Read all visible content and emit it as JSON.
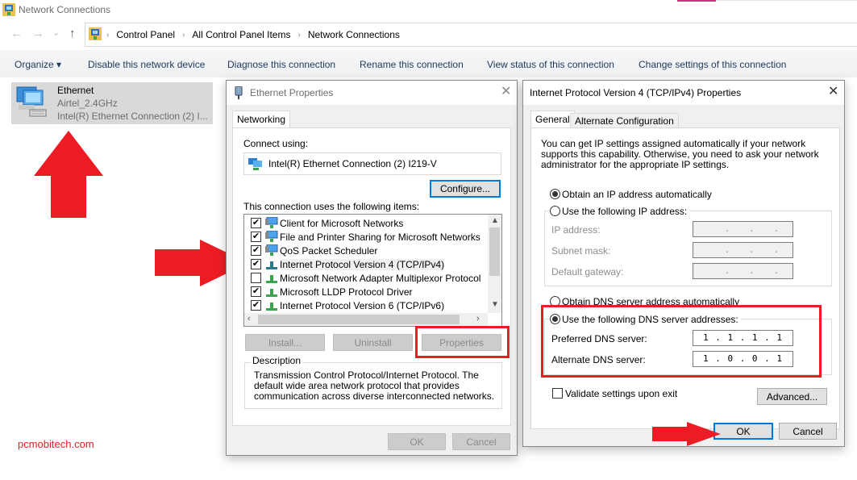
{
  "window": {
    "title": "Network Connections",
    "icon": "network-connections-icon"
  },
  "nav": {
    "back": "←",
    "forward": "→",
    "recent": "⌄",
    "up": "↑"
  },
  "breadcrumb": [
    "Control Panel",
    "All Control Panel Items",
    "Network Connections"
  ],
  "breadcrumb_sep": "›",
  "commands": {
    "organize": "Organize ▾",
    "disable": "Disable this network device",
    "diagnose": "Diagnose this connection",
    "rename": "Rename this connection",
    "view_status": "View status of this connection",
    "change_settings": "Change settings of this connection"
  },
  "connection": {
    "name": "Ethernet",
    "network": "Airtel_2.4GHz",
    "adapter": "Intel(R) Ethernet Connection (2) I..."
  },
  "watermark": "pcmobitech.com",
  "ethernet_properties": {
    "title": "Ethernet Properties",
    "close": "✕",
    "tab": "Networking",
    "connect_using_label": "Connect using:",
    "adapter": "Intel(R) Ethernet Connection (2) I219-V",
    "configure": "Configure...",
    "items_label": "This connection uses the following items:",
    "items": [
      {
        "label": "Client for Microsoft Networks",
        "checked": true,
        "icon": "client-network-icon"
      },
      {
        "label": "File and Printer Sharing for Microsoft Networks",
        "checked": true,
        "icon": "service-network-icon"
      },
      {
        "label": "QoS Packet Scheduler",
        "checked": true,
        "icon": "service-network-icon"
      },
      {
        "label": "Internet Protocol Version 4 (TCP/IPv4)",
        "checked": true,
        "icon": "protocol-icon",
        "selected": true
      },
      {
        "label": "Microsoft Network Adapter Multiplexor Protocol",
        "checked": false,
        "icon": "protocol-icon"
      },
      {
        "label": "Microsoft LLDP Protocol Driver",
        "checked": true,
        "icon": "protocol-icon"
      },
      {
        "label": "Internet Protocol Version 6 (TCP/IPv6)",
        "checked": true,
        "icon": "protocol-icon"
      }
    ],
    "check_mark": "✔",
    "install": "Install...",
    "uninstall": "Uninstall",
    "properties": "Properties",
    "description_label": "Description",
    "description": "Transmission Control Protocol/Internet Protocol. The default wide area network protocol that provides communication across diverse interconnected networks.",
    "ok": "OK",
    "cancel": "Cancel"
  },
  "ipv4_properties": {
    "title": "Internet Protocol Version 4 (TCP/IPv4) Properties",
    "close": "✕",
    "tabs": [
      "General",
      "Alternate Configuration"
    ],
    "intro": "You can get IP settings assigned automatically if your network supports this capability. Otherwise, you need to ask your network administrator for the appropriate IP settings.",
    "obtain_ip_auto": "Obtain an IP address automatically",
    "use_following_ip": "Use the following IP address:",
    "ip_address_label": "IP address:",
    "subnet_label": "Subnet mask:",
    "gateway_label": "Default gateway:",
    "ip_address": "   .   .   .",
    "subnet_mask": "   .   .   .",
    "gateway": "   .   .   .",
    "obtain_dns_auto": "Obtain DNS server address automatically",
    "use_following_dns": "Use the following DNS server addresses:",
    "preferred_dns_label": "Preferred DNS server:",
    "alternate_dns_label": "Alternate DNS server:",
    "preferred_dns": "1 . 1 . 1 . 1",
    "alternate_dns": "1 . 0 . 0 . 1",
    "validate": "Validate settings upon exit",
    "validate_checked": false,
    "advanced": "Advanced...",
    "ok": "OK",
    "cancel": "Cancel"
  },
  "colors": {
    "annotation_red": "#ed1c24",
    "focus_blue": "#0078d7",
    "accent_pink": "#d0307f"
  }
}
